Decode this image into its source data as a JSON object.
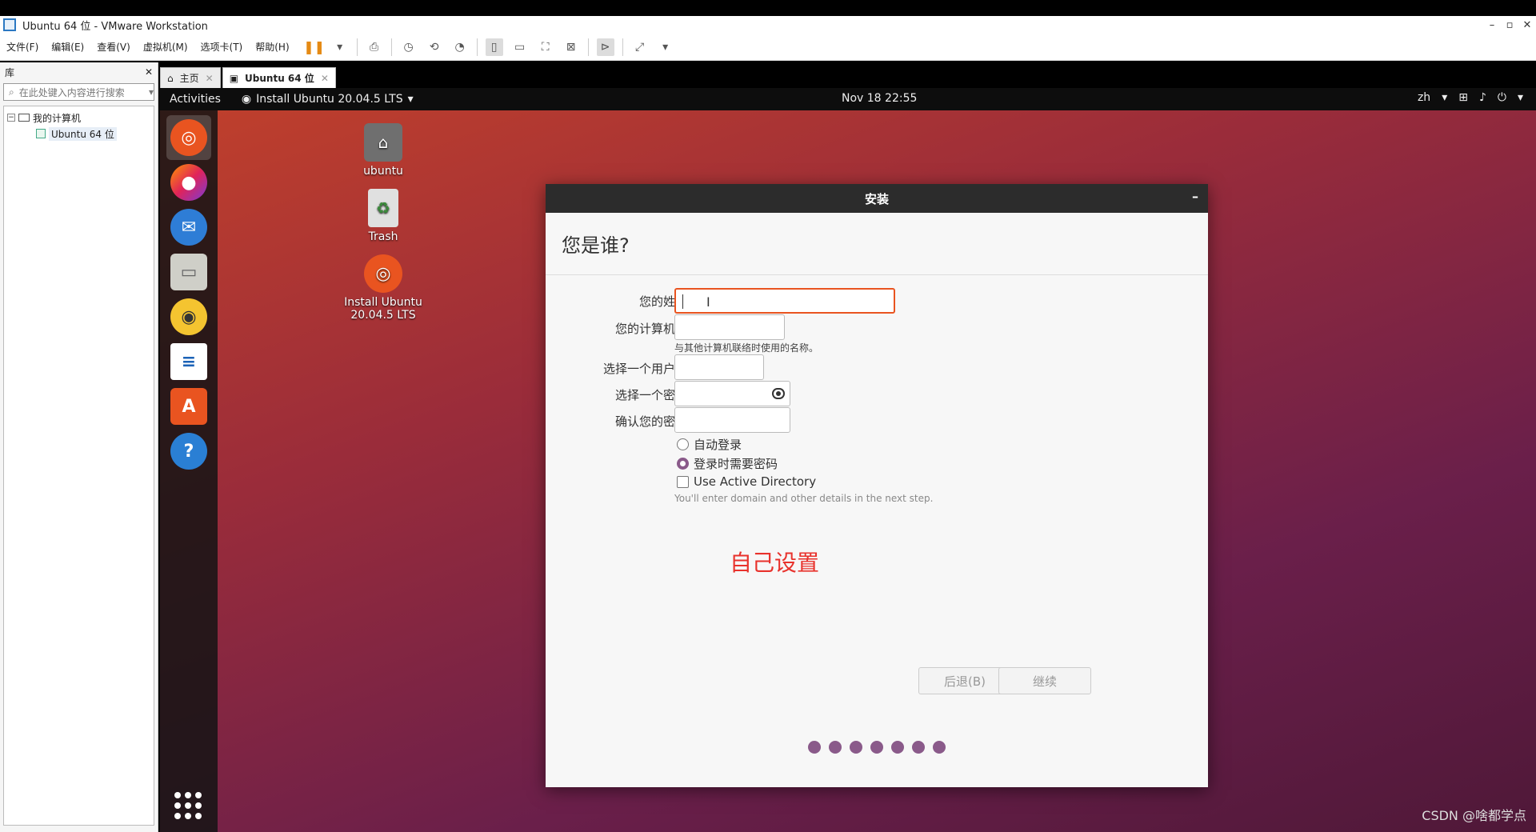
{
  "window": {
    "title": "Ubuntu 64 位 - VMware Workstation",
    "controls": [
      "–",
      "▫",
      "✕"
    ]
  },
  "menu": [
    "文件(F)",
    "编辑(E)",
    "查看(V)",
    "虚拟机(M)",
    "选项卡(T)",
    "帮助(H)"
  ],
  "library": {
    "title": "库",
    "close": "✕",
    "search_placeholder": "在此处键入内容进行搜索",
    "tree": {
      "root": "我的计算机",
      "child": "Ubuntu 64 位"
    }
  },
  "tabs": [
    {
      "label": "主页"
    },
    {
      "label": "Ubuntu 64 位"
    }
  ],
  "gnome": {
    "activities": "Activities",
    "app": "Install Ubuntu 20.04.5 LTS",
    "clock": "Nov 18  22:55",
    "lang": "zh"
  },
  "desktop": {
    "home": "ubuntu",
    "trash": "Trash",
    "installer_line1": "Install Ubuntu",
    "installer_line2": "20.04.5 LTS"
  },
  "dialog": {
    "title": "安装",
    "minimize": "–",
    "heading": "您是谁?",
    "fields": {
      "name_label": "您的姓名:",
      "computer_label": "您的计算机名:",
      "computer_hint": "与其他计算机联络时使用的名称。",
      "username_label": "选择一个用户名:",
      "password_label": "选择一个密码:",
      "confirm_label": "确认您的密码:"
    },
    "options": {
      "auto_login": "自动登录",
      "require_password": "登录时需要密码",
      "active_directory": "Use Active Directory",
      "ad_hint": "You'll enter domain and other details in the next step."
    },
    "annotation": "自己设置",
    "back_button": "后退(B)",
    "continue_button": "继续"
  },
  "watermark": "CSDN @啥都学点",
  "colors": {
    "accent": "#e95420",
    "progress": "#8a5a8a",
    "annotation": "#e8322c"
  }
}
